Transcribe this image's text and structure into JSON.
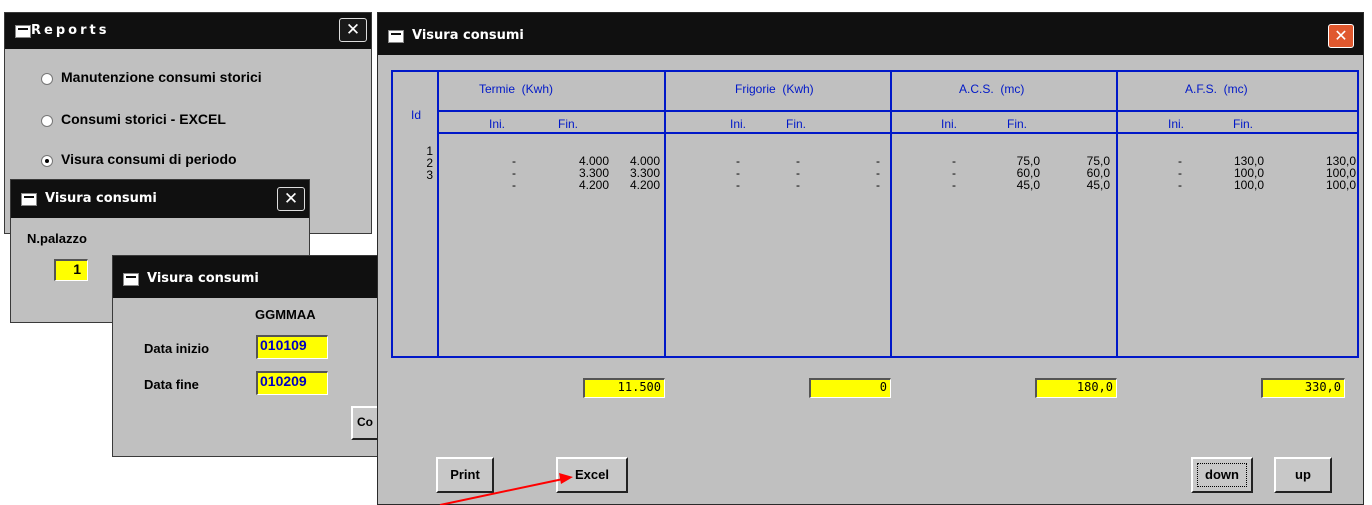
{
  "reports_window": {
    "title": "Reports",
    "options": [
      {
        "label": "Manutenzione consumi storici",
        "selected": false
      },
      {
        "label": "Consumi storici - EXCEL",
        "selected": false
      },
      {
        "label": "Visura consumi di periodo",
        "selected": true
      }
    ]
  },
  "palazzo_window": {
    "title": "Visura consumi",
    "field_label": "N.palazzo",
    "value": "1"
  },
  "date_window": {
    "title": "Visura consumi",
    "format_label": "GGMMAA",
    "start_label": "Data inizio",
    "start_value": "010109",
    "end_label": "Data fine",
    "end_value": "010209",
    "partial_button": "Co"
  },
  "main_window": {
    "title": "Visura consumi",
    "id_header": "Id",
    "groups": [
      {
        "name": "Termie  (Kwh)",
        "ini": "Ini.",
        "fin": "Fin.",
        "total": "11.500"
      },
      {
        "name": "Frigorie  (Kwh)",
        "ini": "Ini.",
        "fin": "Fin.",
        "total": "0"
      },
      {
        "name": "A.C.S.  (mc)",
        "ini": "Ini.",
        "fin": "Fin.",
        "total": "180,0"
      },
      {
        "name": "A.F.S.  (mc)",
        "ini": "Ini.",
        "fin": "Fin.",
        "total": "330,0"
      }
    ],
    "ids": [
      "1",
      "2",
      "3"
    ],
    "rows": [
      [
        "-",
        "4.000",
        "4.000",
        "-",
        "-",
        "-",
        "-",
        "75,0",
        "75,0",
        "-",
        "130,0",
        "130,0"
      ],
      [
        "-",
        "3.300",
        "3.300",
        "-",
        "-",
        "-",
        "-",
        "60,0",
        "60,0",
        "-",
        "100,0",
        "100,0"
      ],
      [
        "-",
        "4.200",
        "4.200",
        "-",
        "-",
        "-",
        "-",
        "45,0",
        "45,0",
        "-",
        "100,0",
        "100,0"
      ]
    ],
    "buttons": {
      "print": "Print",
      "excel": "Excel",
      "down": "down",
      "up": "up"
    }
  },
  "colors": {
    "grid": "#0018c8",
    "field": "#ffff00",
    "annotation_arrow": "#ff0000"
  }
}
